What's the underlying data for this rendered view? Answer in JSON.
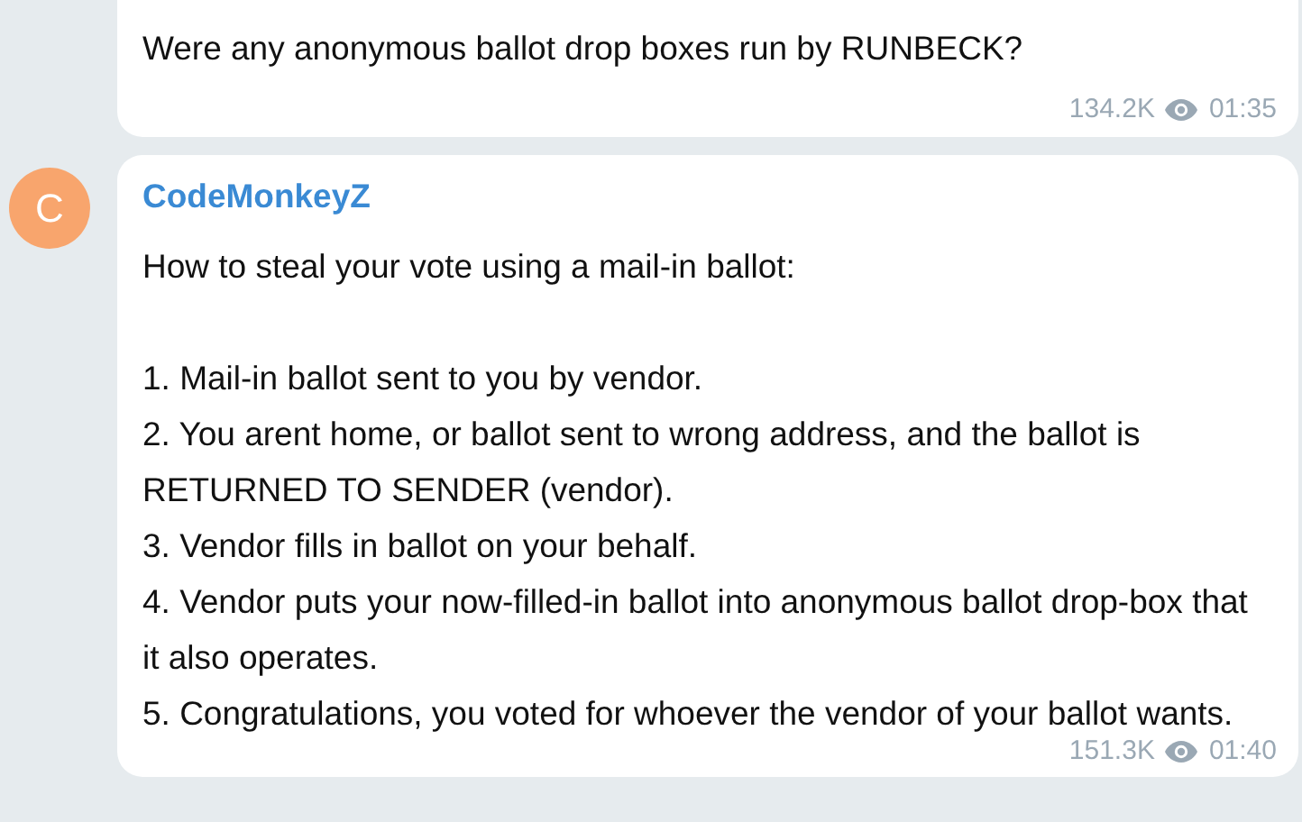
{
  "messages": [
    {
      "paragraphs": [
        [
          "Were any anonymous ballot drop boxes run by RUNBECK?"
        ]
      ],
      "views": "134.2K",
      "time": "01:35"
    },
    {
      "avatar": "C",
      "author": "CodeMonkeyZ",
      "paragraphs": [
        [
          "How to steal your vote using a mail-in ballot:"
        ],
        [
          "1. Mail-in ballot sent to you by vendor.",
          "2. You arent home, or ballot sent to wrong address, and the ballot is RETURNED TO SENDER (vendor).",
          "3. Vendor fills in ballot on your behalf.",
          "4. Vendor puts your now-filled-in ballot into anonymous ballot drop-box that it also operates.",
          "5. Congratulations, you voted for whoever the vendor of your ballot wants."
        ]
      ],
      "views": "151.3K",
      "time": "01:40"
    }
  ]
}
